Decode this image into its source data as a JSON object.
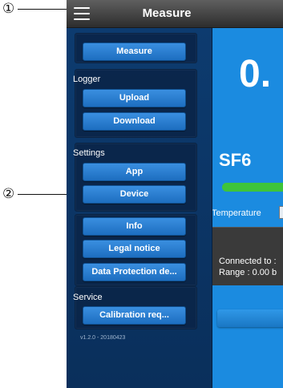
{
  "callouts": [
    {
      "label": "①"
    },
    {
      "label": "②"
    }
  ],
  "topbar": {
    "title": "Measure",
    "menu_icon": "hamburger-menu-icon"
  },
  "drawer": {
    "measure_button": "Measure",
    "logger": {
      "label": "Logger",
      "upload_button": "Upload",
      "download_button": "Download"
    },
    "settings": {
      "label": "Settings",
      "app_button": "App",
      "device_button": "Device"
    },
    "info_button": "Info",
    "legal_button": "Legal notice",
    "data_protection_button": "Data Protection de...",
    "service": {
      "label": "Service",
      "calibration_button": "Calibration req..."
    },
    "version": "v1.2.0 - 20180423"
  },
  "main": {
    "value": "0.",
    "gas": "SF6",
    "level_bar": {
      "color": "#3ec43a"
    },
    "temperature_label": "Temperature",
    "status": {
      "line1": "Connected to :",
      "line2": "Range : 0.00 b"
    }
  },
  "colors": {
    "screen_bg": "#1b8be0",
    "drawer_bg": "#0d3b6f",
    "button_bg": "#2a80d4",
    "topbar_bg": "#3a3a3a"
  }
}
